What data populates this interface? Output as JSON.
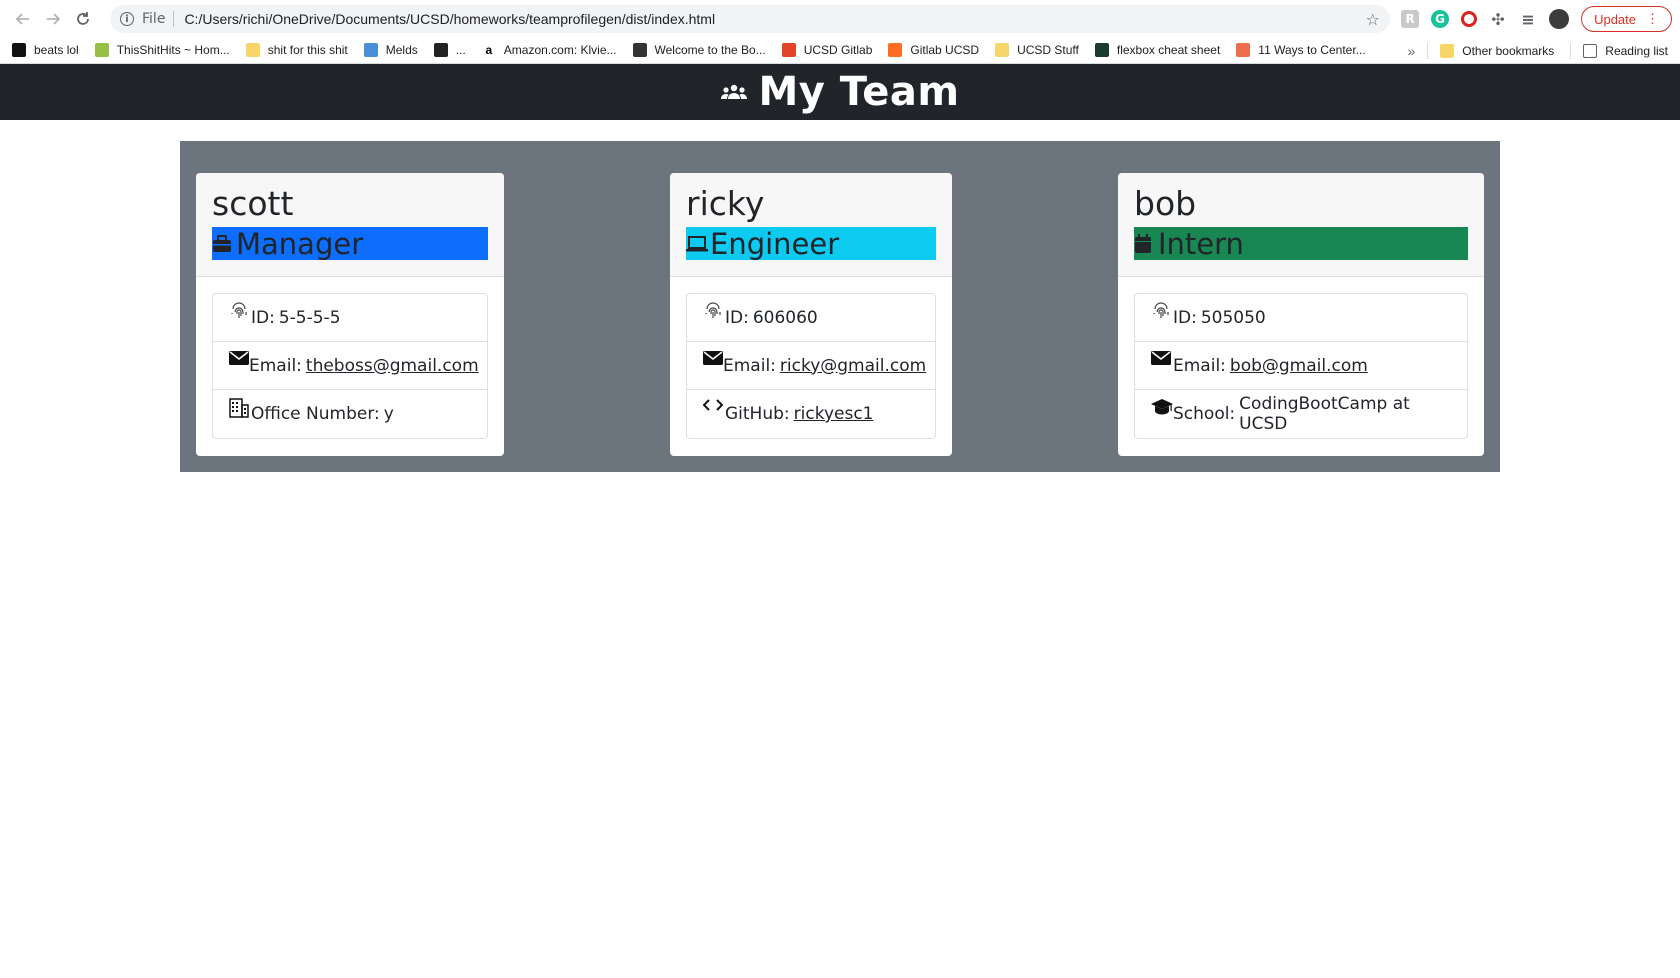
{
  "browser": {
    "omnibox": {
      "scheme_label": "File",
      "url": "C:/Users/richi/OneDrive/Documents/UCSD/homeworks/teamprofilegen/dist/index.html"
    },
    "update_label": "Update",
    "bookmarks": [
      {
        "label": "beats lol"
      },
      {
        "label": "ThisShitHits ~ Hom..."
      },
      {
        "label": "shit for this shit"
      },
      {
        "label": "Melds"
      },
      {
        "label": "..."
      },
      {
        "label": "Amazon.com: Klvie..."
      },
      {
        "label": "Welcome to the Bo..."
      },
      {
        "label": "UCSD Gitlab"
      },
      {
        "label": "Gitlab UCSD"
      },
      {
        "label": "UCSD Stuff"
      },
      {
        "label": "flexbox cheat sheet"
      },
      {
        "label": "11 Ways to Center..."
      }
    ],
    "overflow_label": "»",
    "other_bookmarks": "Other bookmarks",
    "reading_list": "Reading list"
  },
  "page": {
    "title": "My Team",
    "colors": {
      "header_bg": "#212529",
      "panel_bg": "#6c757d",
      "manager": "#0d6efd",
      "engineer": "#0dcaf0",
      "intern": "#198754"
    },
    "employees": [
      {
        "name": "scott",
        "role": "Manager",
        "role_icon": "briefcase-icon",
        "id_label": "ID:",
        "id": "5-5-5-5",
        "email_label": "Email:",
        "email": "theboss@gmail.com",
        "extra_label": "Office Number:",
        "extra": "y",
        "extra_icon": "building-icon"
      },
      {
        "name": "ricky",
        "role": "Engineer",
        "role_icon": "laptop-icon",
        "id_label": "ID:",
        "id": "606060",
        "email_label": "Email:",
        "email": "ricky@gmail.com",
        "extra_label": "GitHub:",
        "extra": "rickyesc1",
        "extra_icon": "code-icon"
      },
      {
        "name": "bob",
        "role": "Intern",
        "role_icon": "calendar-icon",
        "id_label": "ID:",
        "id": "505050",
        "email_label": "Email:",
        "email": "bob@gmail.com",
        "extra_label": "School:",
        "extra": "CodingBootCamp at UCSD",
        "extra_icon": "graduation-cap-icon"
      }
    ]
  }
}
